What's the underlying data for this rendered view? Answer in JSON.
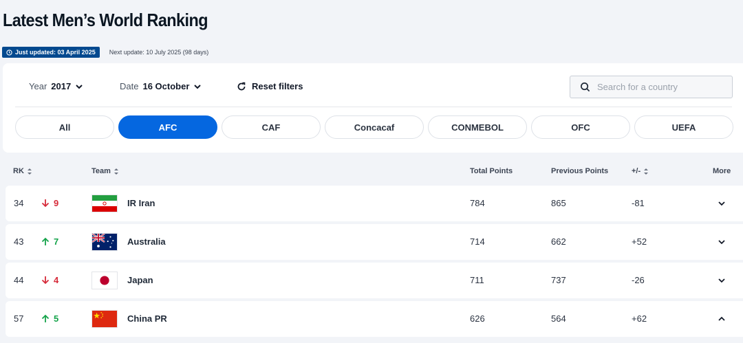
{
  "page": {
    "title": "Latest Men’s World Ranking"
  },
  "update": {
    "just_updated": "Just updated: 03 April 2025",
    "next_update": "Next update: 10 July 2025 (98 days)"
  },
  "filters": {
    "year_label": "Year",
    "year_value": "2017",
    "date_label": "Date",
    "date_value": "16 October",
    "reset_label": "Reset filters",
    "search_placeholder": "Search for a country"
  },
  "confederations": [
    {
      "label": "All",
      "active": false
    },
    {
      "label": "AFC",
      "active": true
    },
    {
      "label": "CAF",
      "active": false
    },
    {
      "label": "Concacaf",
      "active": false
    },
    {
      "label": "CONMEBOL",
      "active": false
    },
    {
      "label": "OFC",
      "active": false
    },
    {
      "label": "UEFA",
      "active": false
    }
  ],
  "table": {
    "headers": {
      "rk": "RK",
      "team": "Team",
      "total": "Total Points",
      "previous": "Previous Points",
      "diff": "+/-",
      "more": "More"
    },
    "rows": [
      {
        "rank": "34",
        "move": "9",
        "direction": "down",
        "flag": "iran-flag",
        "team": "IR Iran",
        "total": "784",
        "previous": "865",
        "diff": "-81",
        "expanded": false
      },
      {
        "rank": "43",
        "move": "7",
        "direction": "up",
        "flag": "australia-flag",
        "team": "Australia",
        "total": "714",
        "previous": "662",
        "diff": "+52",
        "expanded": false
      },
      {
        "rank": "44",
        "move": "4",
        "direction": "down",
        "flag": "japan-flag",
        "team": "Japan",
        "total": "711",
        "previous": "737",
        "diff": "-26",
        "expanded": false
      },
      {
        "rank": "57",
        "move": "5",
        "direction": "up",
        "flag": "china-flag",
        "team": "China PR",
        "total": "626",
        "previous": "564",
        "diff": "+62",
        "expanded": true
      }
    ]
  },
  "colors": {
    "accent": "#0567e0",
    "badge": "#03498f",
    "down": "#d62b3a",
    "up": "#14a34a"
  }
}
